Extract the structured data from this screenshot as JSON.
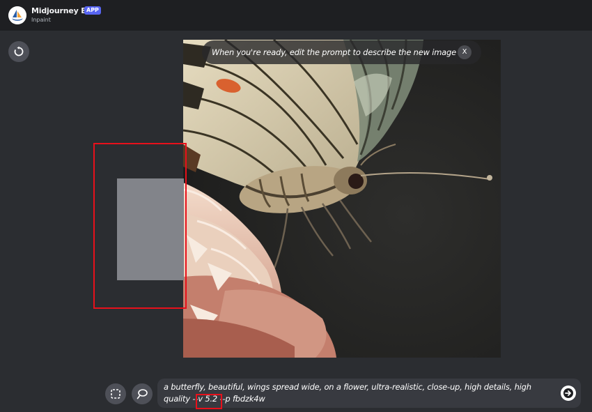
{
  "header": {
    "bot_name": "Midjourney Bot",
    "badge": "APP",
    "subtitle": "Inpaint",
    "avatar_icon": "midjourney-sailboat-logo"
  },
  "toolbar": {
    "undo_icon": "undo-icon"
  },
  "canvas": {
    "image_subject": "butterfly-on-flower",
    "hint": {
      "text": "When you're ready, edit the prompt to describe the new image",
      "close_label": "X"
    }
  },
  "tools": {
    "rectangle_icon": "rectangle-select-icon",
    "lasso_icon": "lasso-icon"
  },
  "prompt": {
    "value": "a butterfly, beautiful, wings spread wide, on a flower, ultra-realistic, close-up, high details, high quality --v 5.2 --p fbdzk4w",
    "send_icon": "send-arrow-icon"
  },
  "colors": {
    "background": "#2b2d31",
    "header": "#1e1f22",
    "accent_badge": "#5865f2",
    "highlight": "#e8101b",
    "selection": "#82848a",
    "input": "#383a40"
  }
}
